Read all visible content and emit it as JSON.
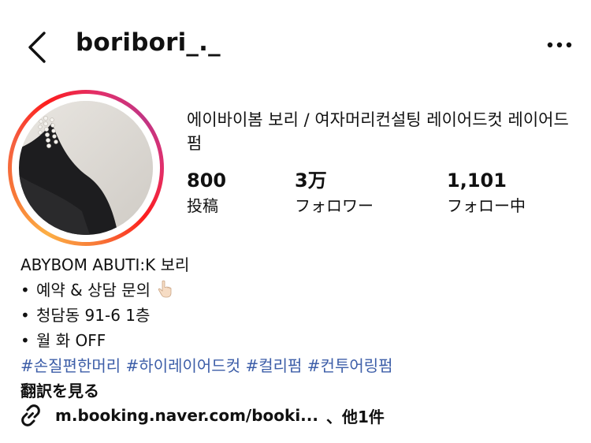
{
  "header": {
    "username": "boribori_._"
  },
  "profile": {
    "display_name": "에이바이봄 보리 / 여자머리컨설팅 레이어드컷 레이어드펌",
    "stats": [
      {
        "value": "800",
        "label": "投稿"
      },
      {
        "value": "3万",
        "label": "フォロワー"
      },
      {
        "value": "1,101",
        "label": "フォロー中"
      }
    ]
  },
  "bio": {
    "name_line": "ABYBOM ABUTI:K 보리",
    "bullets": [
      {
        "mark": "•",
        "text": "예약 & 상담 문의"
      },
      {
        "mark": "•",
        "text": "청담동 91-6 1층"
      },
      {
        "mark": "•",
        "text": "월 화 OFF"
      }
    ],
    "hashtags": [
      "#손질편한머리",
      "#하이레이어드컷",
      "#컬리펌",
      "#컨투어링펌"
    ],
    "translate_label": "翻訳を見る"
  },
  "link": {
    "url_text": "m.booking.naver.com/booki...",
    "extra_text": "、他1件"
  },
  "icons": {
    "back": "chevron-left-icon",
    "more": "more-horizontal-icon",
    "link": "link-chain-icon",
    "pointing_hand": "pointing-down-hand-icon"
  },
  "colors": {
    "hashtag": "#3d5ea8",
    "ring_gradient": [
      "#fcaf45",
      "#f77737",
      "#fd1d1d",
      "#e1306c",
      "#c13584"
    ]
  }
}
